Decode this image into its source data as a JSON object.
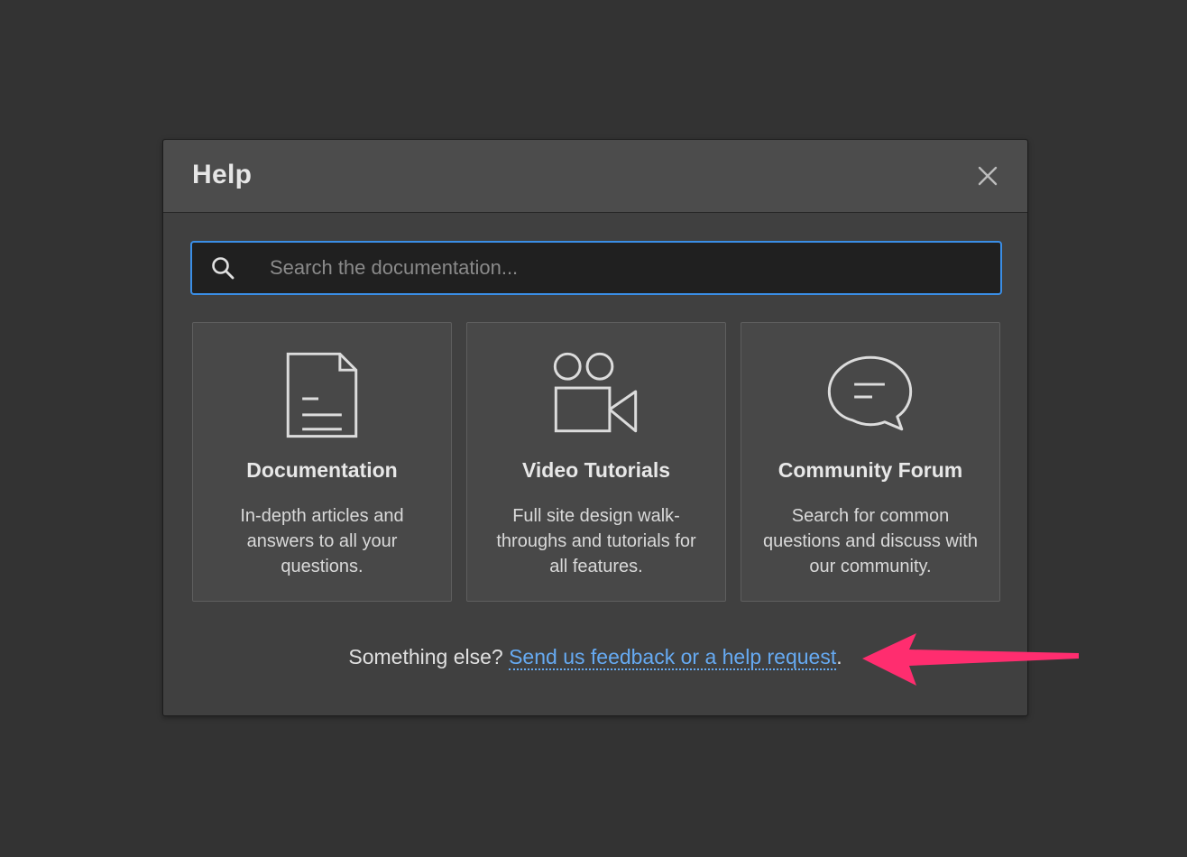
{
  "dialog": {
    "title": "Help",
    "close_icon": "close-icon"
  },
  "search": {
    "placeholder": "Search the documentation...",
    "value": "",
    "icon": "search-icon"
  },
  "cards": [
    {
      "icon": "document-icon",
      "title": "Documentation",
      "description": "In-depth articles and answers to all your questions."
    },
    {
      "icon": "video-camera-icon",
      "title": "Video Tutorials",
      "description": "Full site design walk-throughs and tutorials for all features."
    },
    {
      "icon": "chat-bubble-icon",
      "title": "Community Forum",
      "description": "Search for common questions and discuss with our community."
    }
  ],
  "footer": {
    "prefix": "Something else? ",
    "link": "Send us feedback or a help request",
    "suffix": "."
  },
  "annotation": {
    "icon": "arrow-left-icon",
    "color": "#ff2d6f"
  },
  "colors": {
    "accent": "#3a8ee6",
    "link": "#66aaf2"
  }
}
